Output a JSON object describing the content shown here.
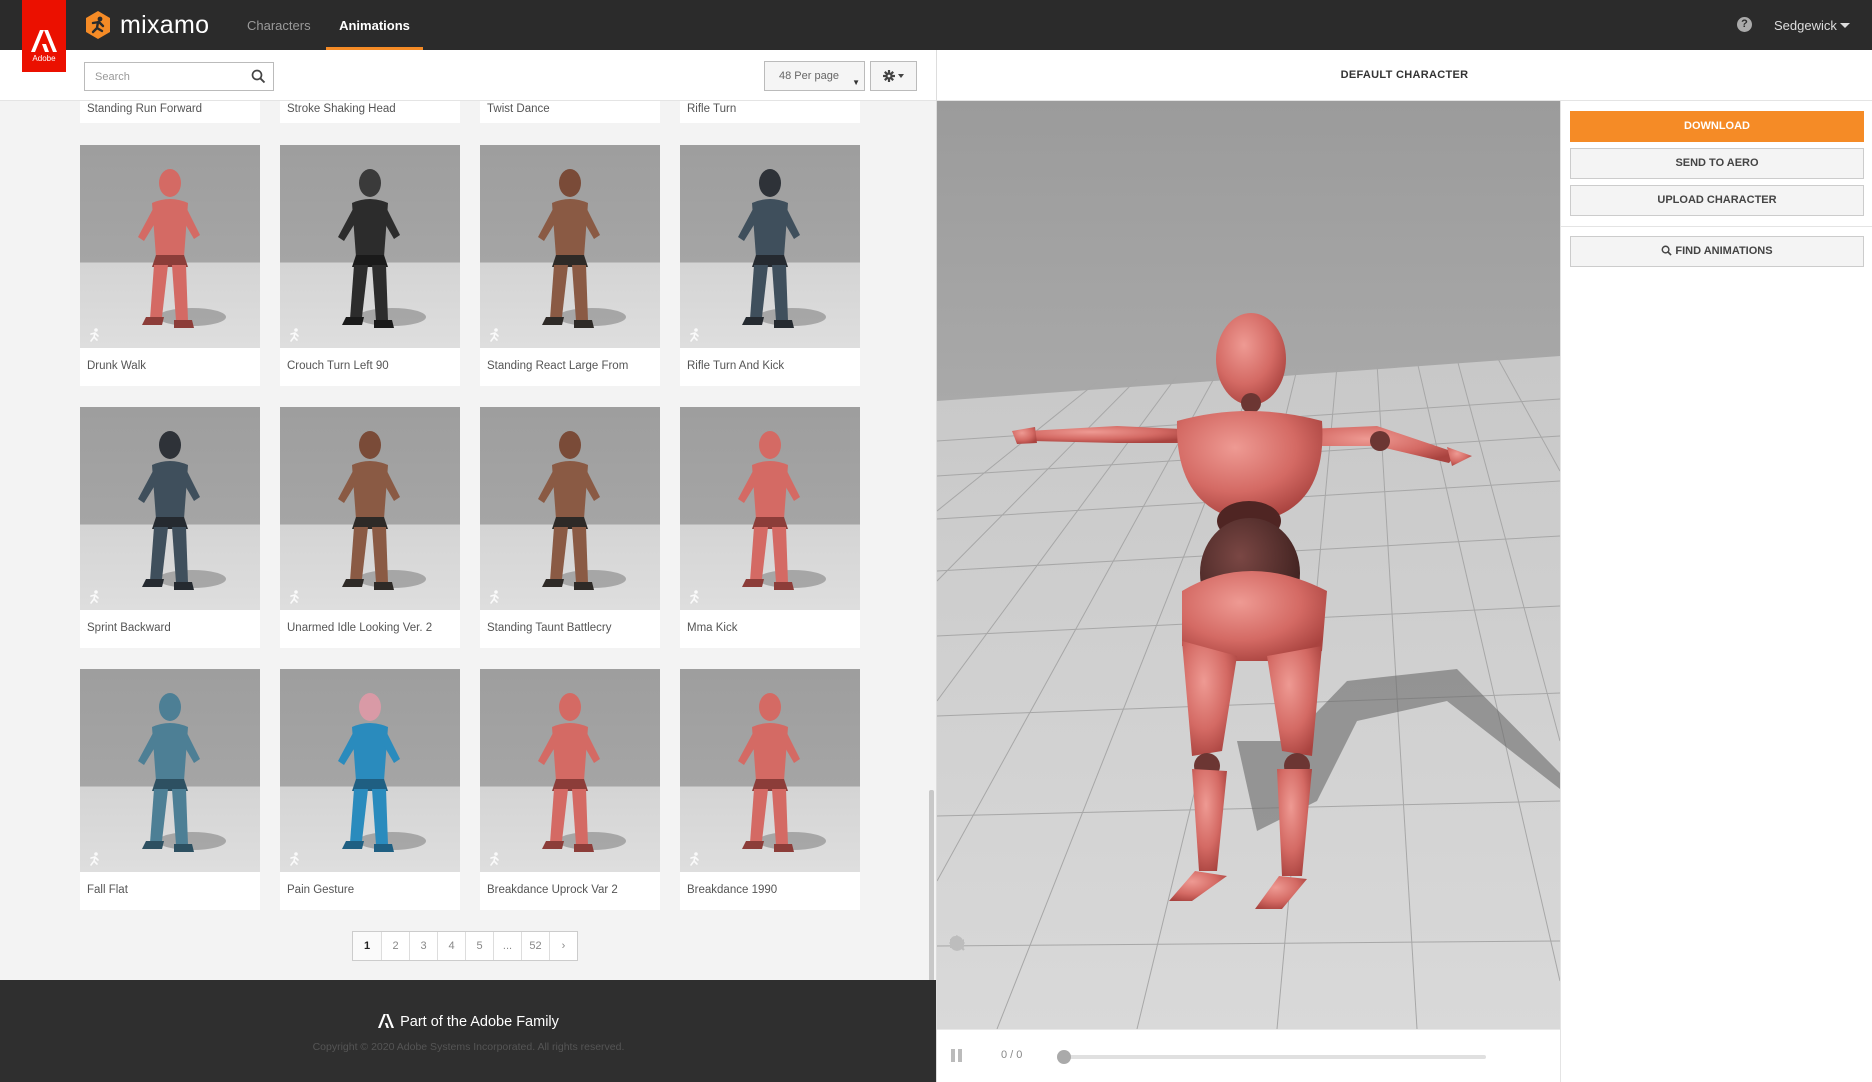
{
  "topbar": {
    "adobe_tab": {
      "label": "Adobe"
    },
    "brand": {
      "name": "mixamo"
    },
    "nav": [
      {
        "label": "Characters",
        "active": false
      },
      {
        "label": "Animations",
        "active": true
      }
    ],
    "help_icon": "question-circle-icon",
    "user": {
      "name": "Sedgewick"
    }
  },
  "toolbar": {
    "search": {
      "placeholder": "Search",
      "value": ""
    },
    "per_page": {
      "selected": "48 Per page"
    },
    "settings_icon": "gear-icon"
  },
  "animations": {
    "partial_row": [
      "Standing Run Forward",
      "Stroke Shaking Head",
      "Twist Dance",
      "Rifle Turn"
    ],
    "cards": [
      {
        "title": "Drunk Walk",
        "model": "pink-mannequin"
      },
      {
        "title": "Crouch Turn Left 90",
        "model": "dark-hooded"
      },
      {
        "title": "Standing React Large From",
        "model": "brute-axe"
      },
      {
        "title": "Rifle Turn And Kick",
        "model": "soldier"
      },
      {
        "title": "Sprint Backward",
        "model": "soldier"
      },
      {
        "title": "Unarmed Idle Looking Ver. 2",
        "model": "brute"
      },
      {
        "title": "Standing Taunt Battlecry",
        "model": "brute-axe"
      },
      {
        "title": "Mma Kick",
        "model": "pink-mannequin"
      },
      {
        "title": "Fall Flat",
        "model": "blue-mannequin"
      },
      {
        "title": "Pain Gesture",
        "model": "cartoon-blue"
      },
      {
        "title": "Breakdance Uprock Var 2",
        "model": "pink-mannequin"
      },
      {
        "title": "Breakdance 1990",
        "model": "pink-mannequin"
      }
    ]
  },
  "pagination": {
    "pages": [
      "1",
      "2",
      "3",
      "4",
      "5",
      "...",
      "52",
      "›"
    ],
    "current": "1"
  },
  "footer": {
    "brand": "Part of the Adobe Family",
    "copyright": "Copyright © 2020 Adobe Systems Incorporated. All rights reserved."
  },
  "viewer": {
    "title": "DEFAULT CHARACTER",
    "frame_counter": "0 / 0",
    "progress": 0,
    "tools": [
      "skull-icon",
      "rotate-icon",
      "move-icon",
      "zoom-icon",
      "power-icon",
      "camera-icon"
    ]
  },
  "actions": {
    "download": "DOWNLOAD",
    "send_to_aero": "SEND TO AERO",
    "upload_character": "UPLOAD CHARACTER",
    "find_animations": "FIND ANIMATIONS"
  },
  "colors": {
    "accent": "#f58b26",
    "adobe_red": "#eb1000",
    "topbar": "#2b2b2b",
    "footer": "#2f2f2f",
    "mannequin": "#d46a64"
  }
}
